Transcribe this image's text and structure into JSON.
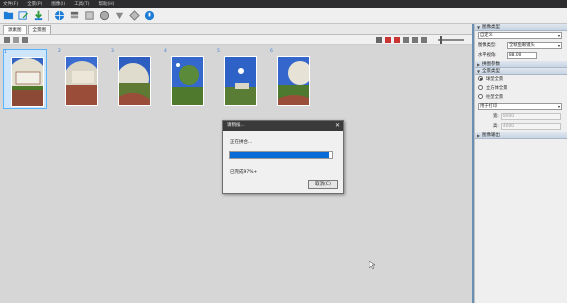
{
  "menu": [
    "文件(F)",
    "全景(P)",
    "图像(I)",
    "工具(T)",
    "帮助(H)"
  ],
  "toolbar": {
    "icons": [
      "open-folder-icon",
      "edit-icon",
      "download-arrow-icon",
      "globe-icon",
      "stack-icon",
      "cube-icon",
      "shield-icon",
      "settings-icon",
      "export-icon",
      "help-icon"
    ]
  },
  "tabs": [
    "源素图",
    "全景图"
  ],
  "thumbnails": [
    {
      "num": "1",
      "selected": true
    },
    {
      "num": "2",
      "selected": false
    },
    {
      "num": "3",
      "selected": false
    },
    {
      "num": "4",
      "selected": false
    },
    {
      "num": "5",
      "selected": false
    },
    {
      "num": "6",
      "selected": false
    }
  ],
  "dialog": {
    "title": "请稍候...",
    "status": "正在拼合...",
    "progress": 0.97,
    "done_text": "已完成97%+",
    "cancel_label": "取消(C)",
    "close": "✕"
  },
  "panel": {
    "image_type_header": "图像类型",
    "preset_value": "自定义",
    "image_type_label": "图像类型:",
    "image_type_value": "全帧鱼眼镜头",
    "hfov_label": "水平视角:",
    "hfov_value": "88.00",
    "stitch_header": "拼图参数",
    "pano_type_header": "全景类型",
    "radio_sphere": "球型全景",
    "radio_cube": "立方体全景",
    "radio_cylinder": "柱型全景",
    "print_value": "用于打印",
    "width_label": "宽:",
    "width_value": "8000",
    "height_label": "高:",
    "height_value": "4000",
    "output_header": "图像输出"
  }
}
